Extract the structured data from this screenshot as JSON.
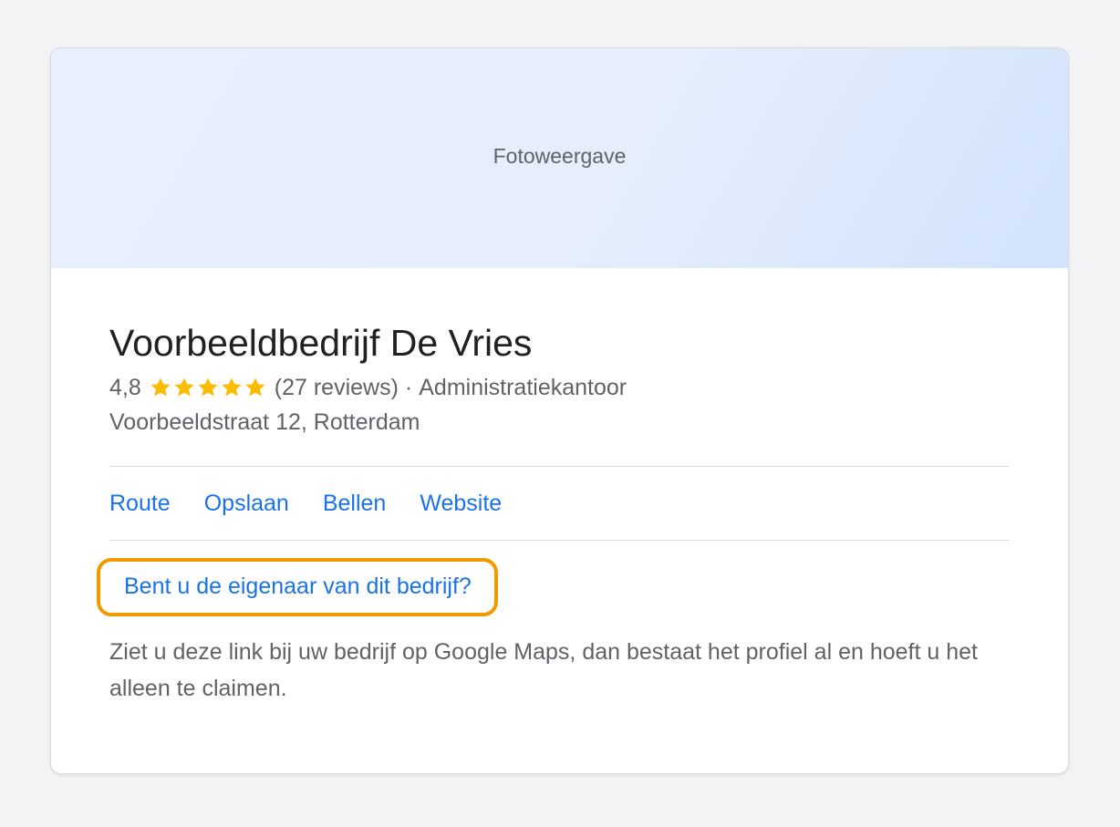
{
  "photo": {
    "label": "Fotoweergave"
  },
  "business": {
    "name": "Voorbeeldbedrijf De Vries",
    "rating": "4,8",
    "rating_value": 4.8,
    "stars_filled": 5,
    "reviews": "(27 reviews)",
    "separator": "·",
    "category": "Administratiekantoor",
    "address": "Voorbeeldstraat 12, Rotterdam"
  },
  "actions": [
    {
      "label": "Route"
    },
    {
      "label": "Opslaan"
    },
    {
      "label": "Bellen"
    },
    {
      "label": "Website"
    }
  ],
  "claim": {
    "label": "Bent u de eigenaar van dit bedrijf?",
    "highlight_color": "#f29900"
  },
  "note": "Ziet u deze link bij uw bedrijf op Google Maps, dan bestaat het profiel al en hoeft u het alleen te claimen.",
  "colors": {
    "link": "#1a73e8",
    "star": "#fbbc04",
    "background": "#f1f3f4"
  }
}
